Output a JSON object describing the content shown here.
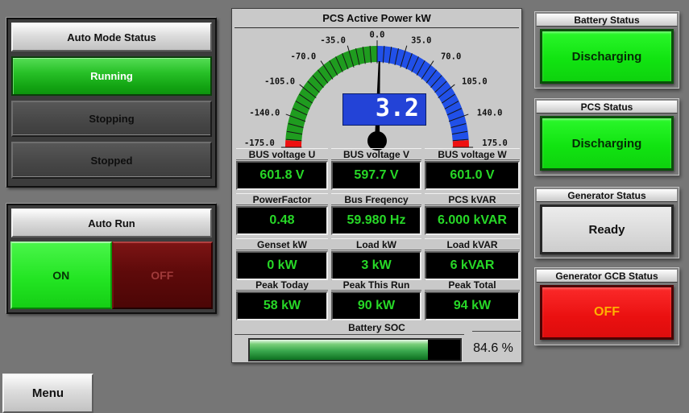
{
  "left": {
    "auto_mode": {
      "title": "Auto Mode Status",
      "buttons": [
        {
          "label": "Running",
          "state": "active"
        },
        {
          "label": "Stopping",
          "state": "inactive"
        },
        {
          "label": "Stopped",
          "state": "inactive"
        }
      ]
    },
    "auto_run": {
      "title": "Auto Run",
      "on_label": "ON",
      "off_label": "OFF",
      "selected": "ON"
    },
    "menu_label": "Menu"
  },
  "center": {
    "title": "PCS Active Power kW",
    "rows": [
      {
        "cells": [
          {
            "label": "BUS voltage U",
            "value": "601.8 V"
          },
          {
            "label": "BUS voltage V",
            "value": "597.7 V"
          },
          {
            "label": "BUS voltage W",
            "value": "601.0 V"
          }
        ]
      },
      {
        "cells": [
          {
            "label": "PowerFactor",
            "value": "0.48"
          },
          {
            "label": "Bus Freqency",
            "value": "59.980 Hz"
          },
          {
            "label": "PCS kVAR",
            "value": "6.000 kVAR"
          }
        ]
      },
      {
        "cells": [
          {
            "label": "Genset kW",
            "value": "0 kW"
          },
          {
            "label": "Load kW",
            "value": "3 kW"
          },
          {
            "label": "Load kVAR",
            "value": "6 kVAR"
          }
        ]
      },
      {
        "cells": [
          {
            "label": "Peak Today",
            "value": "58 kW"
          },
          {
            "label": "Peak This Run",
            "value": "90 kW"
          },
          {
            "label": "Peak Total",
            "value": "94 kW"
          }
        ]
      }
    ],
    "battery_soc": {
      "label": "Battery SOC",
      "percent": 84.6,
      "text": "84.6 %"
    }
  },
  "chart_data": {
    "type": "gauge",
    "title": "PCS Active Power kW",
    "value": 3.2,
    "value_display": "3.2",
    "unit": "kW",
    "min": -175,
    "max": 175,
    "major_tick_step": 35,
    "minor_tick_step": 8.75,
    "tick_labels": [
      "-175.0",
      "-140.0",
      "-105.0",
      "-70.0",
      "-35.0",
      "0.0",
      "35.0",
      "70.0",
      "105.0",
      "140.0",
      "175.0"
    ],
    "bands": [
      {
        "from": -175,
        "to": -167,
        "color": "#ee1010"
      },
      {
        "from": -167,
        "to": 0,
        "color": "#1f9c1f"
      },
      {
        "from": 0,
        "to": 167,
        "color": "#2150e8"
      },
      {
        "from": 167,
        "to": 175,
        "color": "#ee1010"
      }
    ],
    "needle_color": "#000000",
    "readout_bg": "#2343d7"
  },
  "right": {
    "cards": [
      {
        "title": "Battery Status",
        "value": "Discharging",
        "style": "green"
      },
      {
        "title": "PCS Status",
        "value": "Discharging",
        "style": "green"
      },
      {
        "title": "Generator Status",
        "value": "Ready",
        "style": "gray"
      },
      {
        "title": "Generator GCB Status",
        "value": "OFF",
        "style": "red"
      }
    ]
  },
  "colors": {
    "page_bg": "#767676",
    "panel_bg": "#c9c9c9",
    "display_text_green": "#27d827",
    "status_green": "#11e411",
    "status_red": "#ea1010",
    "gcb_off_text": "#ffb000"
  }
}
